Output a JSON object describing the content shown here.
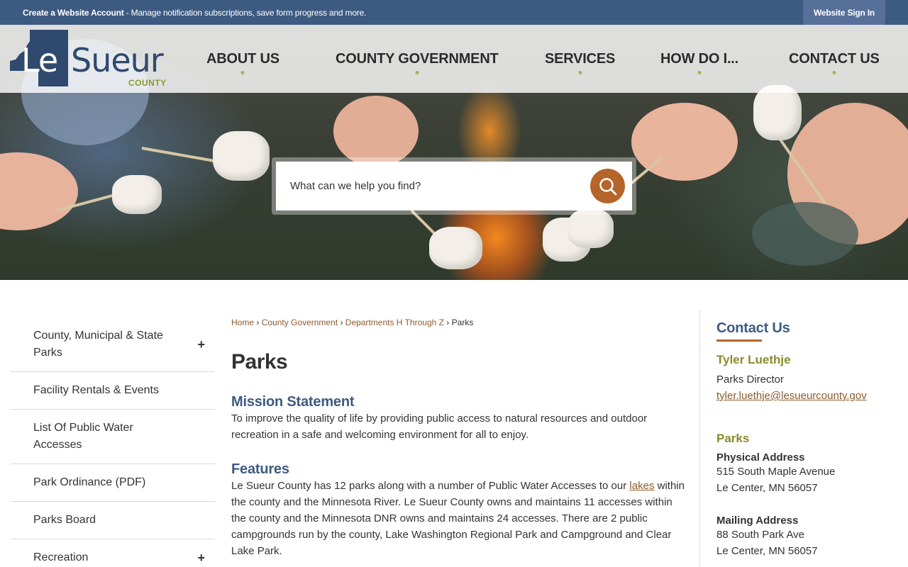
{
  "topbar": {
    "account_label": "Create a Website Account",
    "account_desc": " - Manage notification subscriptions, save form progress and more.",
    "signin_label": "Website Sign In"
  },
  "logo": {
    "le": "Le",
    "sueur": "Sueur",
    "county": "COUNTY"
  },
  "nav": {
    "items": [
      "ABOUT US",
      "COUNTY GOVERNMENT",
      "SERVICES",
      "HOW DO I...",
      "CONTACT US"
    ]
  },
  "search": {
    "placeholder": "What can we help you find?",
    "icon": "search-icon"
  },
  "sidebar": {
    "items": [
      {
        "label": "County, Municipal & State Parks",
        "expand": "+"
      },
      {
        "label": "Facility Rentals & Events"
      },
      {
        "label": "List Of Public Water Accesses"
      },
      {
        "label": "Park Ordinance (PDF)"
      },
      {
        "label": "Parks Board"
      },
      {
        "label": "Recreation",
        "expand": "+"
      }
    ]
  },
  "breadcrumb": {
    "items": [
      "Home",
      "County Government",
      "Departments H Through Z",
      "Parks"
    ],
    "separator": "›"
  },
  "main": {
    "title": "Parks",
    "mission_heading": "Mission Statement",
    "mission_text": "To improve the quality of life by providing public access to natural resources and outdoor recreation in a safe and welcoming environment for all to enjoy.",
    "features_heading": "Features",
    "features_before": "Le Sueur County has 12 parks along with a number of Public Water Accesses to our ",
    "features_link": "lakes",
    "features_after": " within the county and the Minnesota River. Le Sueur County owns and maintains 11 accesses within the county and the Minnesota DNR owns and maintains 24 accesses. There are 2 public campgrounds run by the county, Lake Washington Regional Park and Campground and Clear Lake Park."
  },
  "contact": {
    "heading": "Contact Us",
    "name": "Tyler Luethje",
    "role": "Parks Director",
    "email": "tyler.luethje@lesueurcounty.gov",
    "dept": "Parks",
    "physical_label": "Physical Address",
    "physical_line1": "515 South Maple Avenue",
    "physical_line2": "Le Center, MN 56057",
    "mailing_label": "Mailing Address",
    "mailing_line1": "88 South Park Ave",
    "mailing_line2": "Le Center, MN 56057"
  },
  "colors": {
    "topbar": "#3d5a80",
    "accent": "#b5652a",
    "link": "#8b5b2d",
    "olive": "#8a8a2a"
  }
}
